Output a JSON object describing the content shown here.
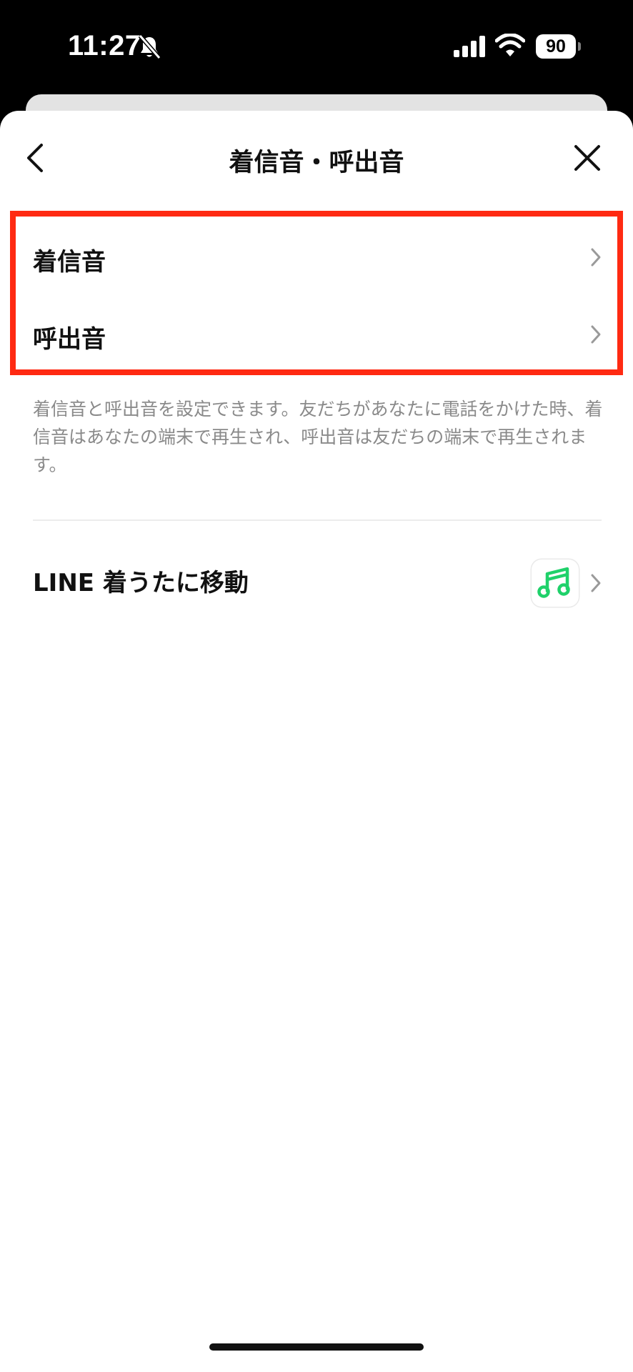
{
  "status_bar": {
    "time": "11:27",
    "battery_level": "90",
    "icons": [
      "bell-muted-icon",
      "signal-icon",
      "wifi-icon",
      "battery-icon"
    ]
  },
  "nav": {
    "title": "着信音・呼出音",
    "back_icon": "chevron-left-icon",
    "close_icon": "close-icon"
  },
  "menu": {
    "items": [
      {
        "label": "着信音",
        "icon": "chevron-right-icon"
      },
      {
        "label": "呼出音",
        "icon": "chevron-right-icon"
      }
    ],
    "description": "着信音と呼出音を設定できます。友だちがあなたに電話をかけた時、着信音はあなたの端末で再生され、呼出音は友だちの端末で再生されます。"
  },
  "link": {
    "label": "LINE 着うたに移動",
    "app_icon": "music-note-icon",
    "icon": "chevron-right-icon"
  },
  "colors": {
    "highlight": "#ff2a12",
    "music_icon": "#1fd16a",
    "description_text": "#8a8a8a"
  }
}
